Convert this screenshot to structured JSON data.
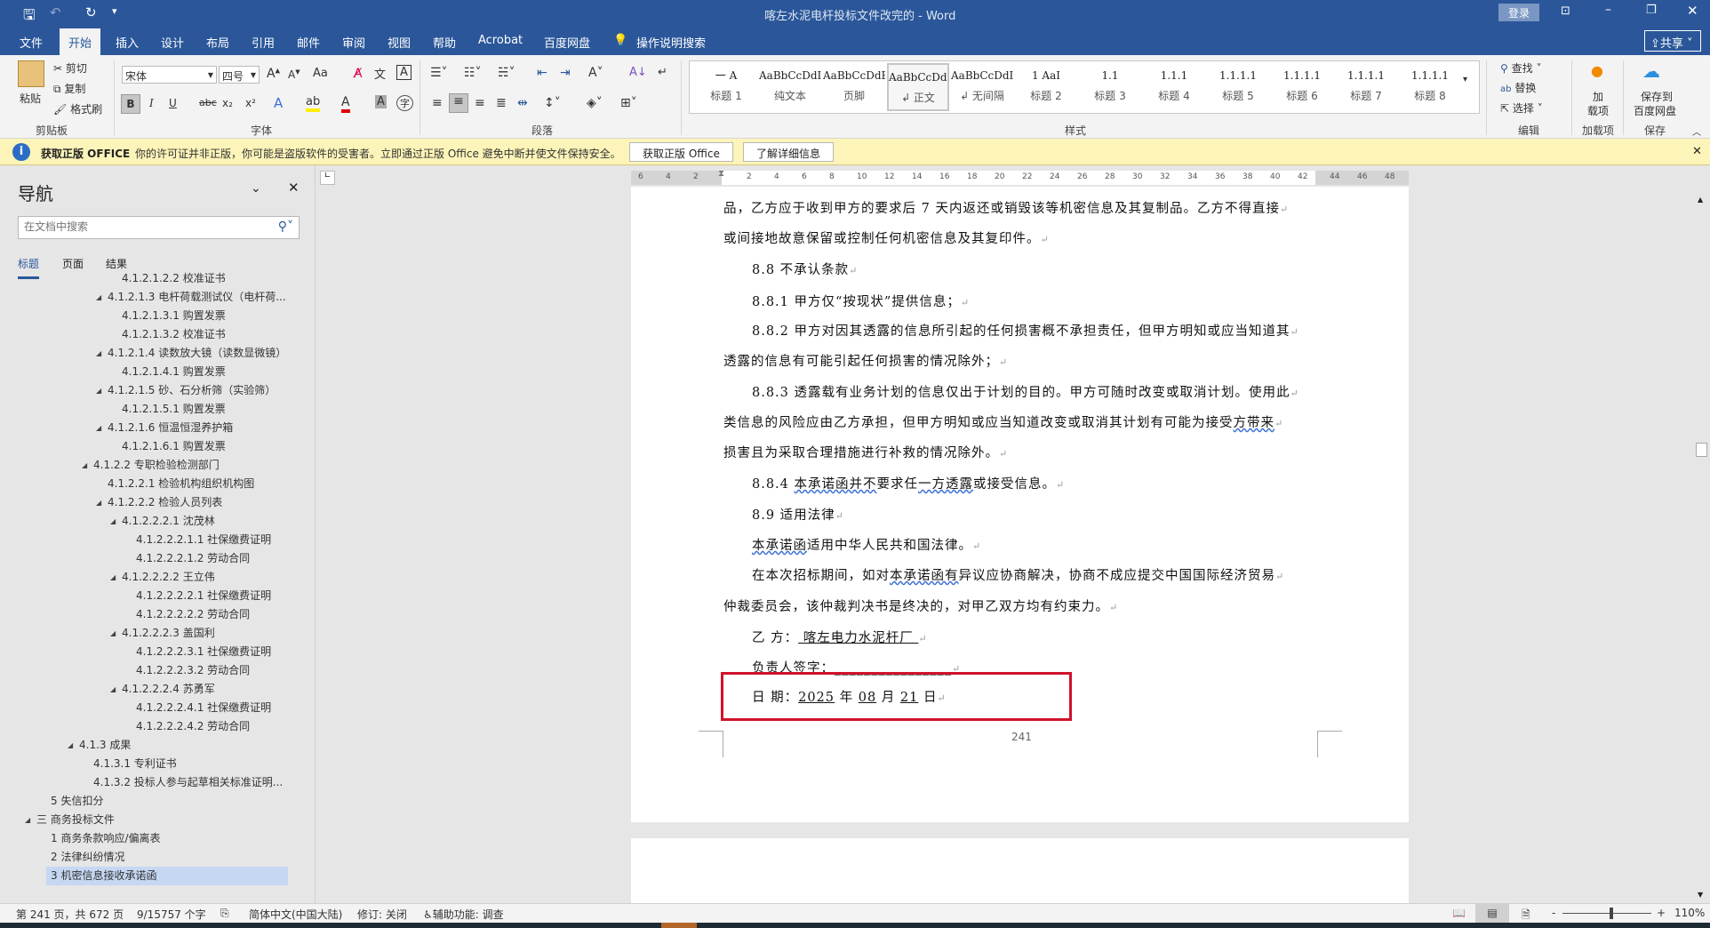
{
  "title_bar": {
    "title": "喀左水泥电杆投标文件改完的 - Word",
    "login": "登录",
    "qat": {
      "save": "save-icon",
      "undo": "undo-icon",
      "redo": "redo-icon",
      "more": "▾"
    }
  },
  "tabs": [
    "文件",
    "开始",
    "插入",
    "设计",
    "布局",
    "引用",
    "邮件",
    "审阅",
    "视图",
    "帮助",
    "Acrobat",
    "百度网盘"
  ],
  "tell_me": "操作说明搜索",
  "share": "共享",
  "ribbon": {
    "clipboard": {
      "paste": "粘贴",
      "cut": "剪切",
      "copy": "复制",
      "format_painter": "格式刷",
      "label": "剪贴板"
    },
    "font": {
      "name": "宋体",
      "size": "四号",
      "label": "字体",
      "case": "Aa",
      "bold": "B",
      "italic": "I",
      "underline": "U",
      "strike": "abc",
      "sub": "x₂",
      "sup": "x²"
    },
    "paragraph": {
      "label": "段落"
    },
    "styles": {
      "label": "样式",
      "items": [
        {
          "preview": "一  A",
          "label": "标题 1"
        },
        {
          "preview": "AaBbCcDdI",
          "label": "纯文本"
        },
        {
          "preview": "AaBbCcDdEe",
          "label": "页脚"
        },
        {
          "preview": "AaBbCcDdI",
          "label": "↲ 正文"
        },
        {
          "preview": "AaBbCcDdI",
          "label": "↲ 无间隔"
        },
        {
          "preview": "1  AaI",
          "label": "标题 2"
        },
        {
          "preview": "1.1",
          "label": "标题 3"
        },
        {
          "preview": "1.1.1",
          "label": "标题 4"
        },
        {
          "preview": "1.1.1.1",
          "label": "标题 5"
        },
        {
          "preview": "1.1.1.1",
          "label": "标题 6"
        },
        {
          "preview": "1.1.1.1",
          "label": "标题 7"
        },
        {
          "preview": "1.1.1.1",
          "label": "标题 8"
        }
      ],
      "selected": 3
    },
    "editing": {
      "find": "查找",
      "replace": "替换",
      "select": "选择",
      "label": "编辑"
    },
    "addins": {
      "btn": "加\n载项",
      "btn1": "加",
      "btn2": "载项",
      "label": "加载项"
    },
    "save": {
      "btn1": "保存到",
      "btn2": "百度网盘",
      "label": "保存"
    }
  },
  "infobar": {
    "title": "获取正版 OFFICE",
    "message": "你的许可证并非正版，你可能是盗版软件的受害者。立即通过正版 Office 避免中断并使文件保持安全。",
    "btn_get": "获取正版 Office",
    "btn_more": "了解详细信息"
  },
  "nav": {
    "title": "导航",
    "search_placeholder": "在文档中搜索",
    "tabs": [
      "标题",
      "页面",
      "结果"
    ],
    "active_tab": 0,
    "items": [
      {
        "t": "4.1.2.1.2.2 校准证书",
        "lv": 6,
        "exp": false
      },
      {
        "t": "4.1.2.1.3 电杆荷载测试仪（电杆荷...",
        "lv": 5,
        "exp": true
      },
      {
        "t": "4.1.2.1.3.1 购置发票",
        "lv": 6,
        "exp": false
      },
      {
        "t": "4.1.2.1.3.2 校准证书",
        "lv": 6,
        "exp": false
      },
      {
        "t": "4.1.2.1.4 读数放大镜（读数显微镜）",
        "lv": 5,
        "exp": true
      },
      {
        "t": "4.1.2.1.4.1 购置发票",
        "lv": 6,
        "exp": false
      },
      {
        "t": "4.1.2.1.5 砂、石分析筛（实验筛）",
        "lv": 5,
        "exp": true
      },
      {
        "t": "4.1.2.1.5.1 购置发票",
        "lv": 6,
        "exp": false
      },
      {
        "t": "4.1.2.1.6 恒温恒湿养护箱",
        "lv": 5,
        "exp": true
      },
      {
        "t": "4.1.2.1.6.1 购置发票",
        "lv": 6,
        "exp": false
      },
      {
        "t": "4.1.2.2 专职检验检测部门",
        "lv": 4,
        "exp": true
      },
      {
        "t": "4.1.2.2.1 检验机构组织机构图",
        "lv": 5,
        "exp": false
      },
      {
        "t": "4.1.2.2.2 检验人员列表",
        "lv": 5,
        "exp": true
      },
      {
        "t": "4.1.2.2.2.1 沈茂林",
        "lv": 6,
        "exp": true
      },
      {
        "t": "4.1.2.2.2.1.1 社保缴费证明",
        "lv": 7,
        "exp": false
      },
      {
        "t": "4.1.2.2.2.1.2 劳动合同",
        "lv": 7,
        "exp": false
      },
      {
        "t": "4.1.2.2.2.2 王立伟",
        "lv": 6,
        "exp": true
      },
      {
        "t": "4.1.2.2.2.2.1 社保缴费证明",
        "lv": 7,
        "exp": false
      },
      {
        "t": "4.1.2.2.2.2.2 劳动合同",
        "lv": 7,
        "exp": false
      },
      {
        "t": "4.1.2.2.2.3 盖国利",
        "lv": 6,
        "exp": true
      },
      {
        "t": "4.1.2.2.2.3.1 社保缴费证明",
        "lv": 7,
        "exp": false
      },
      {
        "t": "4.1.2.2.2.3.2 劳动合同",
        "lv": 7,
        "exp": false
      },
      {
        "t": "4.1.2.2.2.4 苏勇军",
        "lv": 6,
        "exp": true
      },
      {
        "t": "4.1.2.2.2.4.1 社保缴费证明",
        "lv": 7,
        "exp": false
      },
      {
        "t": "4.1.2.2.2.4.2 劳动合同",
        "lv": 7,
        "exp": false
      },
      {
        "t": "4.1.3 成果",
        "lv": 3,
        "exp": true
      },
      {
        "t": "4.1.3.1 专利证书",
        "lv": 4,
        "exp": false
      },
      {
        "t": "4.1.3.2 投标人参与起草相关标准证明...",
        "lv": 4,
        "exp": false
      },
      {
        "t": "5 失信扣分",
        "lv": 1,
        "exp": false
      },
      {
        "t": "三 商务投标文件",
        "lv": 0,
        "exp": true
      },
      {
        "t": "1 商务条款响应/偏离表",
        "lv": 1,
        "exp": false
      },
      {
        "t": "2 法律纠纷情况",
        "lv": 1,
        "exp": false
      },
      {
        "t": "3 机密信息接收承诺函",
        "lv": 1,
        "exp": false,
        "sel": true
      }
    ]
  },
  "ruler": {
    "left": [
      "6",
      "4",
      "2"
    ],
    "mid": [
      "2",
      "4",
      "6",
      "8",
      "10",
      "12",
      "14",
      "16",
      "18",
      "20",
      "22",
      "24",
      "26",
      "28",
      "30",
      "32",
      "34",
      "36",
      "38",
      "40",
      "42"
    ],
    "right": [
      "44",
      "46",
      "48"
    ]
  },
  "document": {
    "lines": [
      {
        "indent": false,
        "parts": [
          {
            "t": "品，乙方应于收到甲方的要求后 7 天内返还或销毁该等机密信息及其复制品。乙方不得直接"
          }
        ]
      },
      {
        "indent": false,
        "parts": [
          {
            "t": "或间接地故意保留或控制任何机密信息及其复印件。"
          }
        ]
      },
      {
        "indent": true,
        "parts": [
          {
            "t": "8.8  不承认条款"
          }
        ]
      },
      {
        "indent": true,
        "parts": [
          {
            "t": "8.8.1  甲方仅“按现状”提供信息；"
          }
        ]
      },
      {
        "indent": true,
        "parts": [
          {
            "t": "8.8.2  甲方对因其透露的信息所引起的任何损害概不承担责任，但甲方明知或应当知道其"
          }
        ]
      },
      {
        "indent": false,
        "parts": [
          {
            "t": "透露的信息有可能引起任何损害的情况除外；"
          }
        ]
      },
      {
        "indent": true,
        "parts": [
          {
            "t": "8.8.3  透露载有业务计划的信息仅出于计划的目的。甲方可随时改变或取消计划。使用此"
          }
        ]
      },
      {
        "indent": false,
        "parts": [
          {
            "t": "类信息的风险应由乙方承担，但甲方明知或应当知道改变或取消其计划有可能为接受"
          },
          {
            "t": "方带来",
            "u": "wavy"
          }
        ]
      },
      {
        "indent": false,
        "parts": [
          {
            "t": "损害且为采取合理措施进行补救的情况除外。"
          }
        ]
      },
      {
        "indent": true,
        "parts": [
          {
            "t": "8.8.4  "
          },
          {
            "t": "本承诺函并不",
            "u": "wavy"
          },
          {
            "t": "要求任"
          },
          {
            "t": "一方透露",
            "u": "wavy"
          },
          {
            "t": "或接受信息。"
          }
        ]
      },
      {
        "indent": true,
        "parts": [
          {
            "t": "8.9  适用法律"
          }
        ]
      },
      {
        "indent": true,
        "parts": [
          {
            "t": "本承诺函",
            "u": "wavy"
          },
          {
            "t": "适用中华人民共和国法律。"
          }
        ]
      },
      {
        "indent": true,
        "parts": [
          {
            "t": "在本次招标期间，如对"
          },
          {
            "t": "本承诺函有",
            "u": "wavy"
          },
          {
            "t": "异议应协商解决，协商不成应提交中国国际经济贸易"
          }
        ]
      },
      {
        "indent": false,
        "parts": [
          {
            "t": "仲裁委员会，该仲裁判决书是终决的，对甲乙双方均有约束力。"
          }
        ]
      },
      {
        "indent": true,
        "parts": [
          {
            "t": "乙        方："
          },
          {
            "t": "  喀左电力水泥杆厂  ",
            "u": "line"
          }
        ]
      },
      {
        "indent": true,
        "parts": [
          {
            "t": "负责人签字："
          },
          {
            "t": "________________"
          }
        ]
      },
      {
        "indent": true,
        "parts": [
          {
            "t": "日        期："
          },
          {
            "t": "2025",
            "u": "line"
          },
          {
            "t": " 年 "
          },
          {
            "t": "08",
            "u": "line"
          },
          {
            "t": " 月 "
          },
          {
            "t": "21",
            "u": "line"
          },
          {
            "t": " 日"
          }
        ]
      }
    ],
    "page_number": "241"
  },
  "status": {
    "page": "第 241 页，共 672 页",
    "words": "9/15757 个字",
    "language": "简体中文(中国大陆)",
    "track": "修订: 关闭",
    "accessibility": "辅助功能: 调查",
    "zoom": "110%",
    "zoom_level": 110
  },
  "colors": {
    "title": "#2b579a",
    "infobar": "#fcf4b8",
    "highlight": "#d0112b",
    "nav_selected": "#c5d7f2"
  }
}
